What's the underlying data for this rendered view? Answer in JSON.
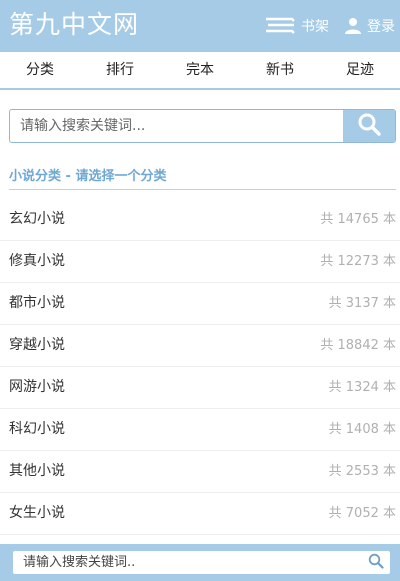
{
  "header": {
    "logo": "第九中文网",
    "shelf_label": "书架",
    "login_label": "登录"
  },
  "nav": {
    "items": [
      {
        "label": "分类"
      },
      {
        "label": "排行"
      },
      {
        "label": "完本"
      },
      {
        "label": "新书"
      },
      {
        "label": "足迹"
      }
    ]
  },
  "search": {
    "placeholder": "请输入搜索关键词...",
    "button_icon": "search-icon"
  },
  "section": {
    "title": "小说分类 - 请选择一个分类"
  },
  "categories": [
    {
      "name": "玄幻小说",
      "count": "共 14765 本"
    },
    {
      "name": "修真小说",
      "count": "共 12273 本"
    },
    {
      "name": "都市小说",
      "count": "共 3137 本"
    },
    {
      "name": "穿越小说",
      "count": "共 18842 本"
    },
    {
      "name": "网游小说",
      "count": "共 1324 本"
    },
    {
      "name": "科幻小说",
      "count": "共 1408 本"
    },
    {
      "name": "其他小说",
      "count": "共 2553 本"
    },
    {
      "name": "女生小说",
      "count": "共 7052 本"
    }
  ],
  "footer_search": {
    "placeholder": "请输入搜索关键词..",
    "button_icon": "search-icon"
  },
  "colors": {
    "accent": "#a5cbe6",
    "section_title": "#6ea8d3",
    "count_text": "#b0b0b0"
  }
}
